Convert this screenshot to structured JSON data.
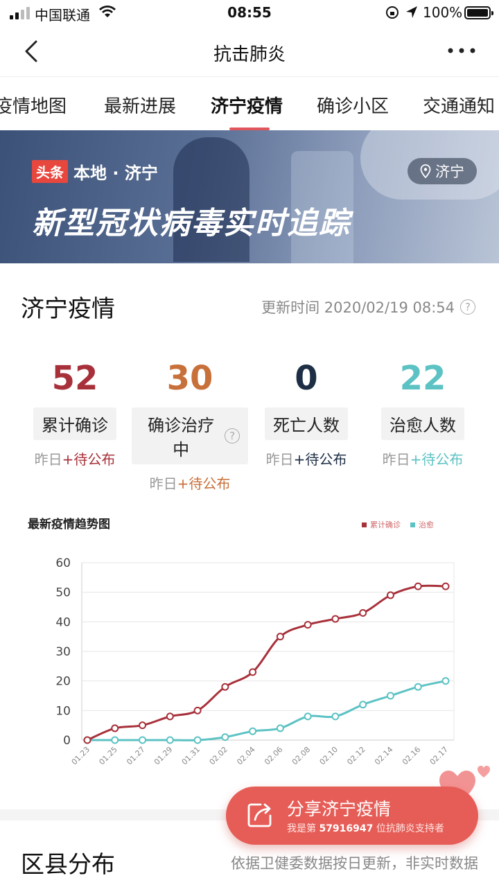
{
  "status_bar": {
    "carrier": "中国联通",
    "time": "08:55",
    "battery": "100%"
  },
  "nav": {
    "title": "抗击肺炎"
  },
  "tabs": [
    "疫情地图",
    "最新进展",
    "济宁疫情",
    "确诊小区",
    "交通通知"
  ],
  "banner": {
    "badge": "头条",
    "brand": "本地 · 济宁",
    "location": "济宁",
    "headline": "新型冠状病毒实时追踪"
  },
  "section": {
    "title": "济宁疫情",
    "update_time": "更新时间 2020/02/19 08:54"
  },
  "stats": [
    {
      "value": "52",
      "label": "累计确诊",
      "prefix": "昨日",
      "delta": "+待公布",
      "color": "#a8303a"
    },
    {
      "value": "30",
      "label": "确诊治疗中",
      "prefix": "昨日",
      "delta": "+待公布",
      "color": "#c8703a"
    },
    {
      "value": "0",
      "label": "死亡人数",
      "prefix": "昨日",
      "delta": "+待公布",
      "color": "#1e2e45"
    },
    {
      "value": "22",
      "label": "治愈人数",
      "prefix": "昨日",
      "delta": "+待公布",
      "color": "#5cc2c3"
    }
  ],
  "chart_data": {
    "type": "line",
    "title": "最新疫情趋势图",
    "x": [
      "01.23",
      "01.25",
      "01.27",
      "01.29",
      "01.31",
      "02.02",
      "02.04",
      "02.06",
      "02.08",
      "02.10",
      "02.12",
      "02.14",
      "02.16",
      "02.17"
    ],
    "ylim": [
      0,
      60
    ],
    "yticks": [
      0,
      10,
      20,
      30,
      40,
      50,
      60
    ],
    "grid": true,
    "legend": "top-right",
    "series": [
      {
        "name": "累计确诊",
        "color": "#a8303a",
        "values": [
          0,
          4,
          5,
          8,
          10,
          18,
          23,
          35,
          39,
          41,
          43,
          49,
          52,
          52
        ]
      },
      {
        "name": "治愈",
        "color": "#5cc2c3",
        "values": [
          0,
          0,
          0,
          0,
          0,
          1,
          3,
          4,
          8,
          8,
          12,
          15,
          18,
          20
        ]
      }
    ]
  },
  "share": {
    "label": "分享济宁疫情",
    "sub_prefix": "我是第 ",
    "supporter_no": "57916947",
    "sub_suffix": " 位抗肺炎支持者"
  },
  "district": {
    "title": "区县分布",
    "note": "依据卫健委数据按日更新，非实时数据"
  }
}
